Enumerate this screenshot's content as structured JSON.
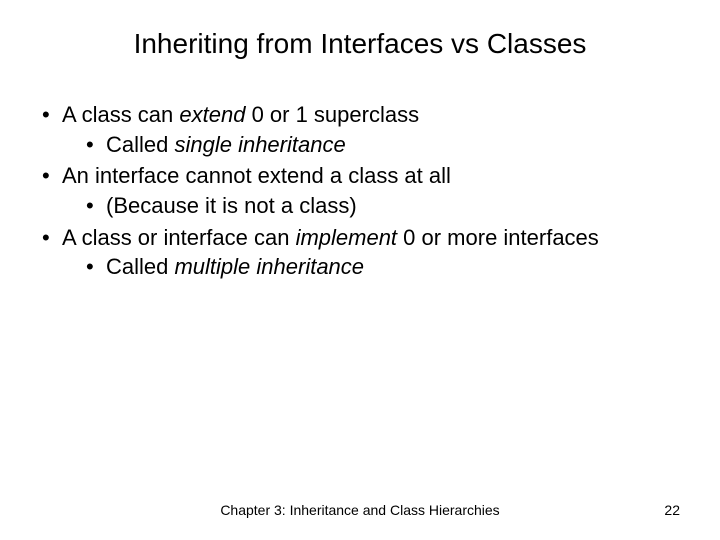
{
  "title": "Inheriting from Interfaces vs Classes",
  "bullets": {
    "b1_pre": "A class can ",
    "b1_em": "extend",
    "b1_post": " 0 or 1 superclass",
    "b1a_pre": "Called ",
    "b1a_em": "single inheritance",
    "b2": "An interface cannot extend a class at all",
    "b2a": "(Because it is not a class)",
    "b3_pre": "A class or interface can ",
    "b3_em": "implement",
    "b3_post": " 0 or more interfaces",
    "b3a_pre": "Called ",
    "b3a_em": "multiple inheritance"
  },
  "footer": "Chapter 3: Inheritance and Class Hierarchies",
  "page_number": "22"
}
